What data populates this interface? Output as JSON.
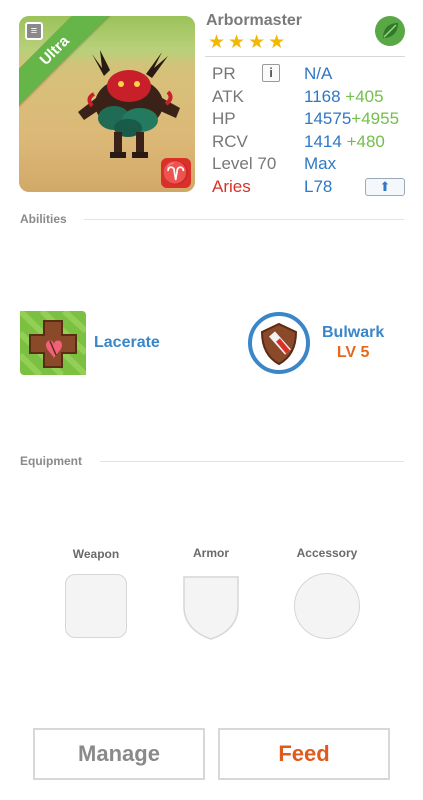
{
  "monster": {
    "name": "Arbormaster",
    "rarity": "Ultra",
    "stars": 4,
    "element_icon": "leaf-icon",
    "corner_icon": "card-icon",
    "zodiac_badge": "♈"
  },
  "stats": {
    "pr": {
      "label": "PR",
      "value": "N/A",
      "info_icon": "i"
    },
    "atk": {
      "label": "ATK",
      "value": "1168",
      "bonus": "+405"
    },
    "hp": {
      "label": "HP",
      "value": "14575",
      "bonus": "+4955"
    },
    "rcv": {
      "label": "RCV",
      "value": "1414",
      "bonus": "+480"
    },
    "level": {
      "label": "Level 70",
      "value": "Max"
    },
    "zodiac": {
      "label": "Aries",
      "value": "L78",
      "upgrade_icon": "⬆"
    }
  },
  "abilities": {
    "title": "Abilities",
    "items": [
      {
        "name": "Lacerate",
        "icon": "lacerate-icon"
      },
      {
        "name": "Bulwark",
        "level": "LV 5",
        "icon": "bulwark-icon"
      }
    ]
  },
  "equipment": {
    "title": "Equipment",
    "slots": [
      {
        "label": "Weapon"
      },
      {
        "label": "Armor"
      },
      {
        "label": "Accessory"
      }
    ]
  },
  "buttons": {
    "manage": "Manage",
    "feed": "Feed"
  },
  "colors": {
    "stat_value": "#2f78c4",
    "stat_bonus": "#72c04a",
    "aries": "#d9302a",
    "ultra_ribbon": "#66b548",
    "ability_name": "#3a86c8",
    "ability_level": "#e36a1d",
    "feed": "#e05a1e",
    "manage": "#8a8a8a"
  }
}
